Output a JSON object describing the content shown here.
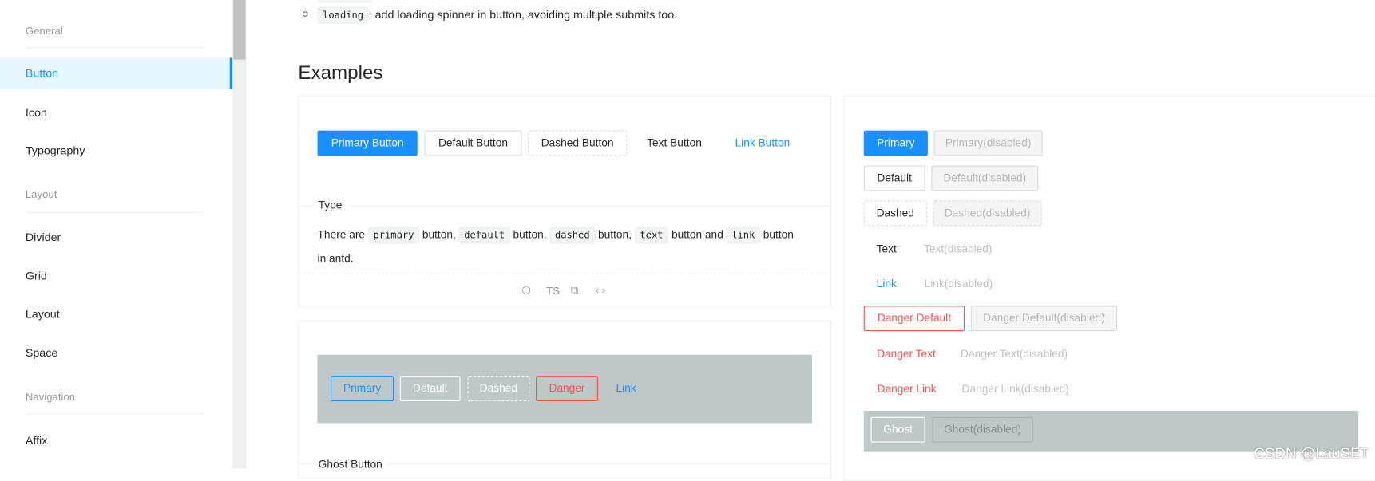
{
  "sidebar": {
    "groups": [
      "General",
      "Layout",
      "Navigation"
    ],
    "items": [
      "Button",
      "Icon",
      "Typography",
      "Divider",
      "Grid",
      "Layout",
      "Space",
      "Affix"
    ],
    "selected": "Button"
  },
  "intro": {
    "code": "loading",
    "text": ": add loading spinner in button, avoiding multiple submits too."
  },
  "examples_heading": "Examples",
  "type_demo": {
    "buttons": [
      "Primary Button",
      "Default Button",
      "Dashed Button",
      "Text Button",
      "Link Button"
    ],
    "title": "Type",
    "desc": {
      "p1": "There are",
      "c1": "primary",
      "p2": "button,",
      "c2": "default",
      "p3": "button,",
      "c3": "dashed",
      "p4": "button,",
      "c4": "text",
      "p5": "button and",
      "c5": "link",
      "p6": "button",
      "p7": "in antd."
    },
    "actions": {
      "codesandbox": "codesandbox-icon",
      "ts": "TS",
      "copy": "copy-icon",
      "code": "code-icon"
    }
  },
  "ghost_demo": {
    "buttons": [
      "Primary",
      "Default",
      "Dashed",
      "Danger",
      "Link"
    ],
    "title": "Ghost Button"
  },
  "disabled_demo": {
    "rows": [
      [
        "Primary",
        "Primary(disabled)"
      ],
      [
        "Default",
        "Default(disabled)"
      ],
      [
        "Dashed",
        "Dashed(disabled)"
      ],
      [
        "Text",
        "Text(disabled)"
      ],
      [
        "Link",
        "Link(disabled)"
      ],
      [
        "Danger Default",
        "Danger Default(disabled)"
      ],
      [
        "Danger Text",
        "Danger Text(disabled)"
      ],
      [
        "Danger Link",
        "Danger Link(disabled)"
      ],
      [
        "Ghost",
        "Ghost(disabled)"
      ]
    ]
  },
  "watermark": "CSDN @LauSET",
  "colors": {
    "primary": "#1890ff",
    "danger": "#ff4d4f",
    "ghost_bg": "#bec8c8",
    "selected_bg": "#e6f7ff"
  }
}
